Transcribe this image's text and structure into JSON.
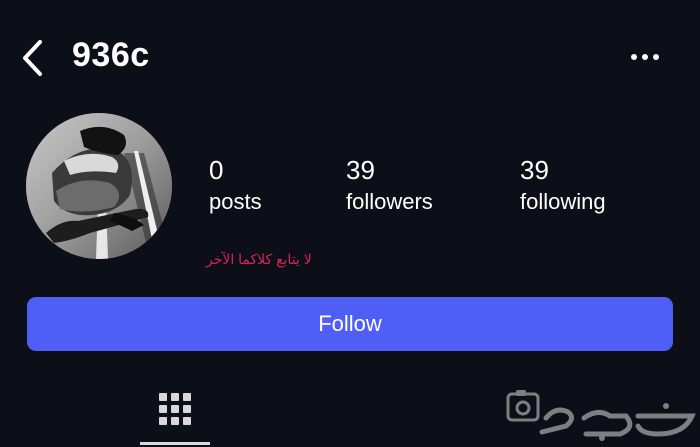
{
  "header": {
    "username": "936c",
    "back_icon": "chevron-left-icon",
    "more_icon": "ellipsis-icon"
  },
  "profile": {
    "avatar_icon": "profile-avatar"
  },
  "stats": [
    {
      "value": "0",
      "label": "posts"
    },
    {
      "value": "39",
      "label": "followers"
    },
    {
      "value": "39",
      "label": "following"
    }
  ],
  "bio": {
    "text": "لا يتابع كلاكما الآخر",
    "color": "#d4245a"
  },
  "follow_button": {
    "label": "Follow",
    "color": "#4f5ff6"
  },
  "tabs": {
    "grid_icon": "grid-icon"
  },
  "watermark": {
    "logo_icon": "haraj-watermark-logo"
  },
  "colors": {
    "background": "#0c0f17",
    "text": "#ffffff"
  }
}
